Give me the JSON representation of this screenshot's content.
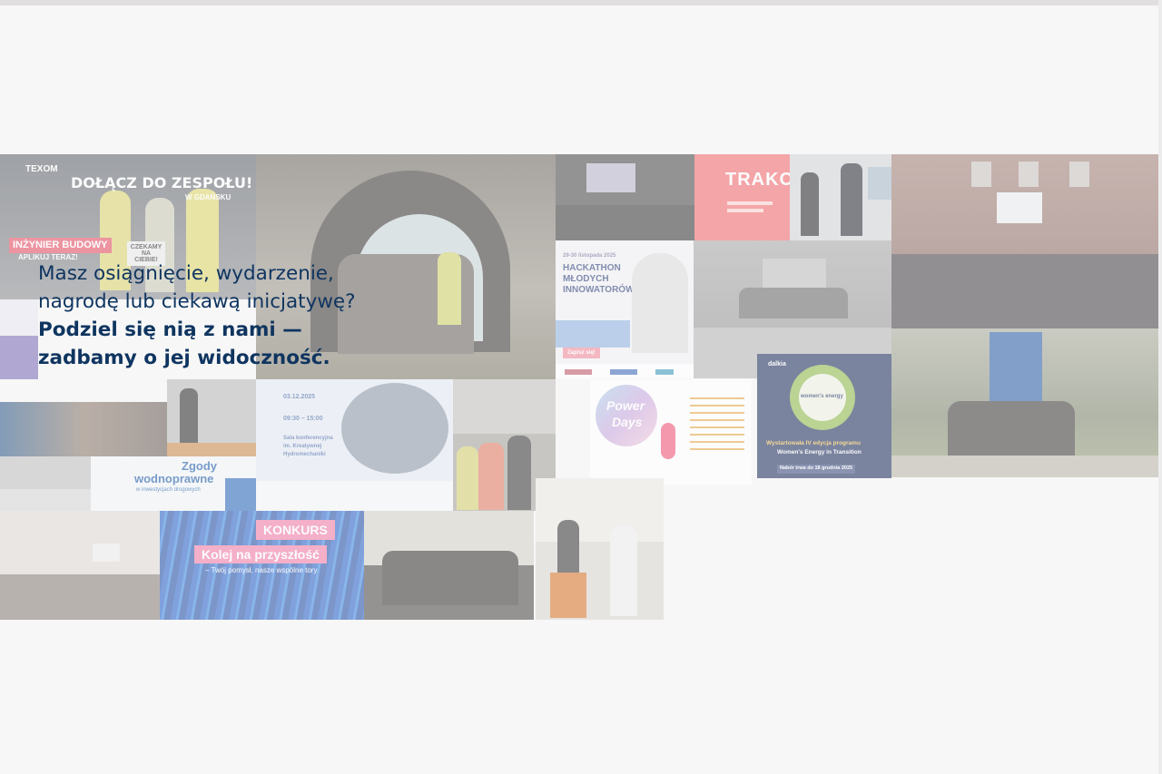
{
  "cta": {
    "line1": "Masz osiągnięcie, wydarzenie,",
    "line2": "nagrodę lub ciekawą inicjatywę?",
    "line3": "Podziel się nią z nami —",
    "line4": "zadbamy o jej widoczność."
  },
  "tiles": {
    "texom": {
      "brand": "TEXOM",
      "headline": "DOŁĄCZ DO ZESPOŁU!",
      "location": "W GDAŃSKU",
      "role": "INŻYNIER BUDOWY",
      "apply": "APLIKUJ TERAZ!",
      "sign": "CZEKAMY NA CIEBIE!"
    },
    "trako": {
      "title": "TRAKO"
    },
    "hackathon": {
      "date": "29-30 listopada 2025",
      "title1": "HACKATHON",
      "title2": "MŁODYCH",
      "title3": "INNOWATORÓW",
      "button": "Zapisz się!"
    },
    "lecture": {
      "date": "03.12.2025",
      "time": "09:30 – 15:00",
      "place1": "Sala konferencyjna",
      "place2": "im. Kreatywnej",
      "place3": "Hydromechaniki"
    },
    "zgody": {
      "line1": "Zgody",
      "line2": "wodnoprawne",
      "line3": "w inwestycjach drogowych"
    },
    "powerdays": {
      "line1": "Power",
      "line2": "Days"
    },
    "dalkia": {
      "brand": "dalkia",
      "logo": "women's energy",
      "line1": "Wystartowała IV edycja programu",
      "line2": "Women's Energy in Transition",
      "deadline": "Nabór trwa do 18 grudnia 2025"
    },
    "konkurs": {
      "badge": "KONKURS",
      "title": "Kolej na przyszłość",
      "subtitle": "– Twój pomysł, nasze wspólne tory"
    }
  },
  "colors": {
    "brand_navy": "#0f3560",
    "page_bg": "#f7f7f7",
    "accent_pink": "#f5a6b3",
    "accent_blue": "#2f67c8"
  }
}
